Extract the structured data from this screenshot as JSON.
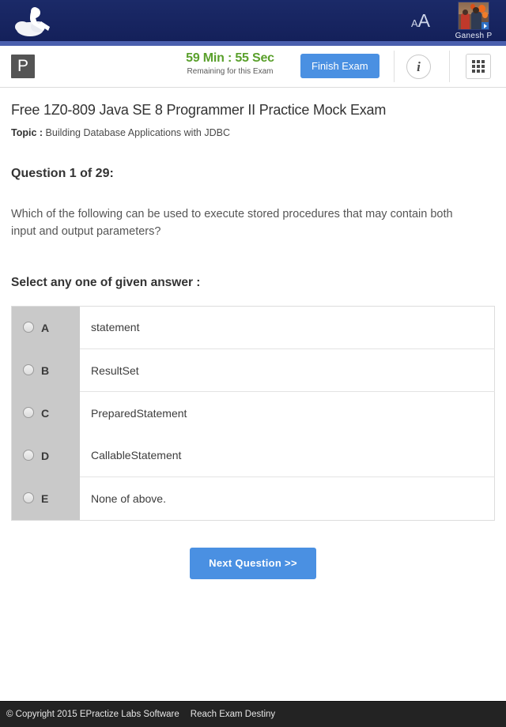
{
  "header": {
    "logo_icon": "cloud-reader-logo-icon",
    "font_size_control": {
      "small": "A",
      "large": "A"
    },
    "user": {
      "name": "Ganesh P",
      "avatar_icon": "user-avatar"
    }
  },
  "toolbar": {
    "pause_label": "P",
    "timer_value": "59 Min : 55 Sec",
    "timer_caption": "Remaining for this Exam",
    "timer_color": "#5aa02c",
    "finish_label": "Finish Exam",
    "finish_color": "#4a90e2",
    "info_icon": "info-icon",
    "info_glyph": "i",
    "grid_icon": "question-grid-icon"
  },
  "exam": {
    "title": "Free 1Z0-809 Java SE 8 Programmer II Practice Mock Exam",
    "topic_label": "Topic :",
    "topic_value": "Building Database Applications with JDBC",
    "question_number": "Question 1 of 29:",
    "question_text": "Which of the following can be used to execute stored procedures that may contain both input and output parameters?",
    "select_prompt": "Select any one of given answer :",
    "options": [
      {
        "key": "A",
        "text": "statement",
        "selected": false
      },
      {
        "key": "B",
        "text": "ResultSet",
        "selected": false
      },
      {
        "key": "C",
        "text": "PreparedStatement",
        "selected": false
      },
      {
        "key": "D",
        "text": "CallableStatement",
        "selected": false
      },
      {
        "key": "E",
        "text": "None of above.",
        "selected": false
      }
    ],
    "next_label": "Next Question >>"
  },
  "footer": {
    "copyright": "© Copyright 2015 EPractize Labs Software",
    "tagline": "Reach Exam Destiny"
  }
}
